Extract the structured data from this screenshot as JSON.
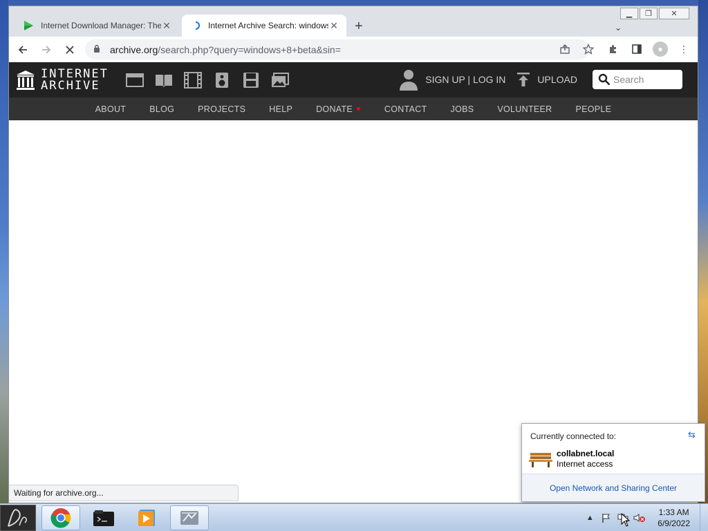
{
  "browser": {
    "tabs": [
      {
        "title": "Internet Download Manager: The",
        "favicon": "play-triangle-icon",
        "active": false
      },
      {
        "title": "Internet Archive Search: windows",
        "favicon": "loading-spinner-icon",
        "active": true
      }
    ],
    "new_tab": "+",
    "url_host": "archive.org",
    "url_path": "/search.php?query=windows+8+beta&sin=",
    "status_text": "Waiting for archive.org..."
  },
  "site": {
    "logo_line1": "INTERNET",
    "logo_line2": "ARCHIVE",
    "media_icons": [
      "web-icon",
      "texts-icon",
      "video-icon",
      "audio-icon",
      "software-icon",
      "images-icon"
    ],
    "signup_label": "SIGN UP | LOG IN",
    "upload_label": "UPLOAD",
    "search_placeholder": "Search",
    "nav": [
      "ABOUT",
      "BLOG",
      "PROJECTS",
      "HELP",
      "DONATE",
      "CONTACT",
      "JOBS",
      "VOLUNTEER",
      "PEOPLE"
    ],
    "donate_heart_color": "#e0101b"
  },
  "network_popup": {
    "header": "Currently connected to:",
    "network_name": "collabnet.local",
    "network_status": "Internet access",
    "link": "Open Network and Sharing Center"
  },
  "taskbar": {
    "apps": [
      "chrome-icon",
      "terminal-folder-icon",
      "media-player-icon",
      "network-tool-icon"
    ],
    "time": "1:33 AM",
    "date": "6/9/2022"
  }
}
